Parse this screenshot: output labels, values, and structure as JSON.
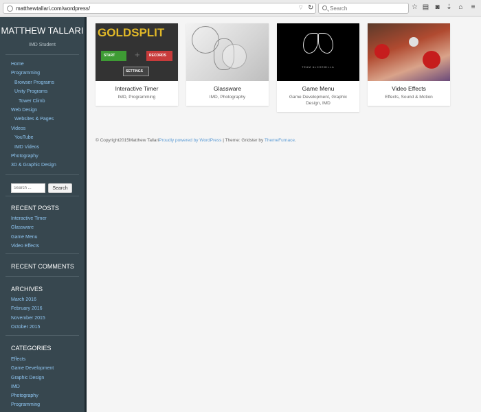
{
  "browser": {
    "url": "matthewtallari.com/wordpress/",
    "search_placeholder": "Search"
  },
  "sidebar": {
    "site_title": "MATTHEW TALLARI",
    "site_description": "IMD Student",
    "nav": [
      {
        "label": "Home",
        "level": 1
      },
      {
        "label": "Programming",
        "level": 1
      },
      {
        "label": "Browser Programs",
        "level": 2
      },
      {
        "label": "Unity Programs",
        "level": 2
      },
      {
        "label": "Tower Climb",
        "level": 3
      },
      {
        "label": "Web Design",
        "level": 1
      },
      {
        "label": "Websites & Pages",
        "level": 2
      },
      {
        "label": "Videos",
        "level": 1
      },
      {
        "label": "YouTube",
        "level": 2
      },
      {
        "label": "IMD Videos",
        "level": 2
      },
      {
        "label": "Photography",
        "level": 1
      },
      {
        "label": "3D & Graphic Design",
        "level": 1
      }
    ],
    "search": {
      "placeholder": "Search ...",
      "button": "Search"
    },
    "recent_posts": {
      "title": "RECENT POSTS",
      "items": [
        "Interactive Timer",
        "Glassware",
        "Game Menu",
        "Video Effects"
      ]
    },
    "recent_comments": {
      "title": "RECENT COMMENTS"
    },
    "archives": {
      "title": "ARCHIVES",
      "items": [
        "March 2016",
        "February 2016",
        "November 2015",
        "October 2015"
      ]
    },
    "categories": {
      "title": "CATEGORIES",
      "items": [
        "Effects",
        "Game Development",
        "Graphic Design",
        "IMD",
        "Photography",
        "Programming"
      ]
    }
  },
  "posts": [
    {
      "title": "Interactive Timer",
      "categories": "IMD, Programming",
      "thumb": {
        "logo": "GOLDSPLIT",
        "start": "START",
        "records": "RECORDS",
        "settings": "SETTINGS"
      }
    },
    {
      "title": "Glassware",
      "categories": "IMD, Photography"
    },
    {
      "title": "Game Menu",
      "categories": "Game Development, Graphic Design, IMD",
      "thumb": {
        "caption": "TEAM ALCHEMILLA"
      }
    },
    {
      "title": "Video Effects",
      "categories": "Effects, Sound & Motion"
    }
  ],
  "footer": {
    "copyright": "© Copyright2015Matthew Tallari",
    "powered": "Proudly powered by WordPress",
    "theme_prefix": " | Theme: Gridster by ",
    "theme_link": "ThemeFurnace",
    "end": "."
  },
  "colors": {
    "sidebar_bg": "#37474f",
    "link": "#8fc6f2",
    "page_bg": "#f5f5f5"
  }
}
